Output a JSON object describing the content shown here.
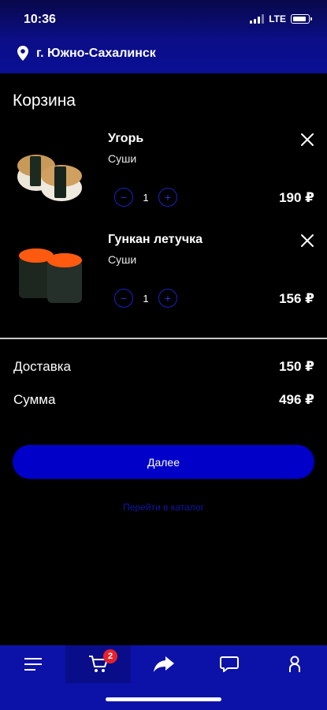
{
  "status_bar": {
    "time": "10:36",
    "network": "LTE"
  },
  "location": {
    "city": "г. Южно-Сахалинск"
  },
  "cart": {
    "title": "Корзина",
    "items": [
      {
        "name": "Угорь",
        "category": "Суши",
        "quantity": "1",
        "price": "190 ₽",
        "image": "eel-nigiri"
      },
      {
        "name": "Гункан летучка",
        "category": "Суши",
        "quantity": "1",
        "price": "156 ₽",
        "image": "tobiko-gunkan"
      }
    ],
    "stepper": {
      "minus": "−",
      "plus": "+"
    }
  },
  "summary": {
    "delivery_label": "Доставка",
    "delivery_value": "150 ₽",
    "total_label": "Сумма",
    "total_value": "496 ₽"
  },
  "actions": {
    "next_label": "Далее",
    "catalog_link": "Перейти в каталог"
  },
  "bottom_nav": {
    "items": [
      {
        "id": "menu",
        "icon": "hamburger-icon"
      },
      {
        "id": "cart",
        "icon": "cart-icon",
        "badge": "2",
        "active": true
      },
      {
        "id": "share",
        "icon": "share-arrow-icon"
      },
      {
        "id": "chat",
        "icon": "chat-bubble-icon"
      },
      {
        "id": "profile",
        "icon": "profile-icon"
      }
    ]
  },
  "colors": {
    "accent": "#0000c8",
    "nav": "#0c12a7",
    "badge": "#e8222b",
    "stepper": "#1b22c6"
  }
}
